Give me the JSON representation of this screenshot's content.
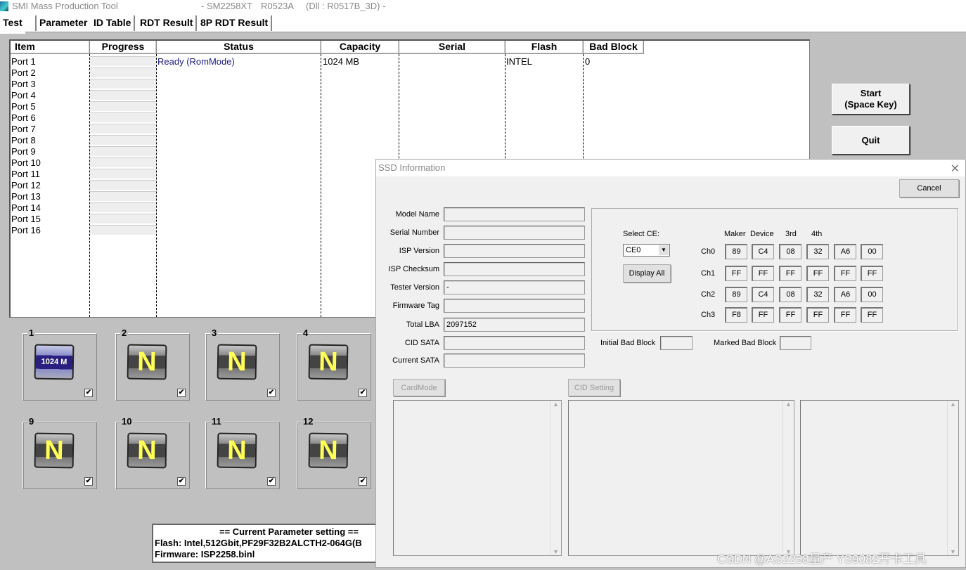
{
  "window": {
    "title": "SMI Mass Production Tool",
    "chip": "- SM2258XT",
    "version": "R0523A",
    "dll": "(Dll : R0517B_3D) -"
  },
  "tabs": [
    "Test",
    "Parameter",
    "ID Table",
    "RDT Result",
    "8P RDT Result"
  ],
  "table": {
    "headers": [
      "Item",
      "Progress",
      "Status",
      "Capacity",
      "Serial",
      "Flash",
      "Bad Block"
    ],
    "ports": [
      "Port 1",
      "Port 2",
      "Port 3",
      "Port 4",
      "Port 5",
      "Port 6",
      "Port 7",
      "Port 8",
      "Port 9",
      "Port 10",
      "Port 11",
      "Port 12",
      "Port 13",
      "Port 14",
      "Port 15",
      "Port 16"
    ],
    "row1": {
      "status": "Ready (RomMode)",
      "capacity": "1024 MB",
      "serial": "",
      "flash": "INTEL",
      "bad_block": "0"
    }
  },
  "buttons": {
    "start_line1": "Start",
    "start_line2": "(Space Key)",
    "quit": "Quit"
  },
  "port_tiles": [
    {
      "num": "1",
      "label": "1024 M",
      "type": "capacity",
      "checked": true
    },
    {
      "num": "2",
      "label": "N",
      "type": "none",
      "checked": true
    },
    {
      "num": "3",
      "label": "N",
      "type": "none",
      "checked": true
    },
    {
      "num": "4",
      "label": "N",
      "type": "none",
      "checked": true
    },
    {
      "num": "9",
      "label": "N",
      "type": "none",
      "checked": true
    },
    {
      "num": "10",
      "label": "N",
      "type": "none",
      "checked": true
    },
    {
      "num": "11",
      "label": "N",
      "type": "none",
      "checked": true
    },
    {
      "num": "12",
      "label": "N",
      "type": "none",
      "checked": true
    }
  ],
  "param": {
    "header": "== Current Parameter setting ==",
    "flash": "Flash:   Intel,512Gbit,PF29F32B2ALCTH2-064G(B",
    "firmware": "Firmware:   ISP2258.binl"
  },
  "dialog": {
    "title": "SSD Information",
    "cancel": "Cancel",
    "fields": [
      {
        "label": "Model Name",
        "value": ""
      },
      {
        "label": "Serial Number",
        "value": ""
      },
      {
        "label": "ISP Version",
        "value": ""
      },
      {
        "label": "ISP Checksum",
        "value": ""
      },
      {
        "label": "Tester Version",
        "value": "-"
      },
      {
        "label": "Firmware Tag",
        "value": ""
      },
      {
        "label": "Total LBA",
        "value": "2097152"
      },
      {
        "label": "CID SATA",
        "value": ""
      },
      {
        "label": "Current SATA",
        "value": ""
      }
    ],
    "select_ce_label": "Select CE:",
    "select_ce_value": "CE0",
    "display_all": "Display All",
    "hex_headers": [
      "Maker",
      "Device",
      "3rd",
      "4th"
    ],
    "channels": [
      {
        "name": "Ch0",
        "values": [
          "89",
          "C4",
          "08",
          "32",
          "A6",
          "00"
        ]
      },
      {
        "name": "Ch1",
        "values": [
          "FF",
          "FF",
          "FF",
          "FF",
          "FF",
          "FF"
        ]
      },
      {
        "name": "Ch2",
        "values": [
          "89",
          "C4",
          "08",
          "32",
          "A6",
          "00"
        ]
      },
      {
        "name": "Ch3",
        "values": [
          "F8",
          "FF",
          "FF",
          "FF",
          "FF",
          "FF"
        ]
      }
    ],
    "initial_bad_block_label": "Initial Bad Block",
    "initial_bad_block": "",
    "marked_bad_block_label": "Marked Bad Block",
    "marked_bad_block": "",
    "cardmode": "CardMode",
    "cid_setting": "CID Setting"
  },
  "watermark": "CSDN @AS2258量产 YS9082开卡工具"
}
